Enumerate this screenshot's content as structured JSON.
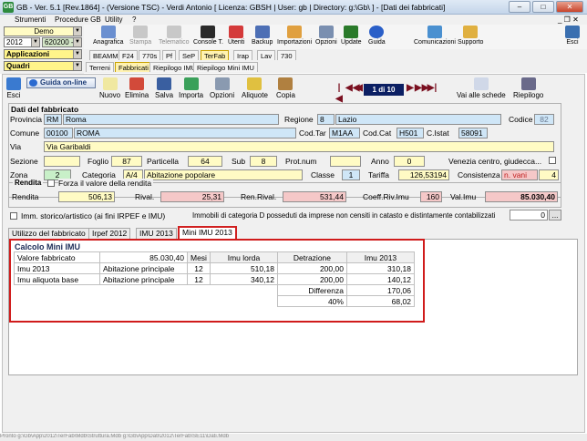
{
  "window": {
    "title": "GB - Ver. 5.1 [Rev.1864] - (Versione TSC) - Verdi Antonio [ Licenza: GBSH | User: gb | Directory: g:\\Gb\\ ] - [Dati dei fabbricati]",
    "min": "–",
    "max": "□",
    "close": "✕"
  },
  "menu": {
    "items": [
      "Strumenti",
      "Procedure GB",
      "Utility",
      "?"
    ],
    "restore": "_ ❐ ✕"
  },
  "left": {
    "company": "Demo",
    "year": "2012",
    "code": "620200 -",
    "module": "Applicazioni",
    "sub": "Quadri"
  },
  "toolbar": {
    "buttons": [
      "Anagrafica",
      "Stampa",
      "Telematico",
      "Console T.",
      "Utenti",
      "Backup",
      "Importazioni",
      "Opzioni",
      "Update",
      "Guida",
      "Comunicazioni",
      "Supporto",
      "Esci"
    ]
  },
  "tabs_row1": [
    "BEAMM",
    "F24",
    "770s",
    "Pf",
    "SeP",
    "TerFab",
    "Irap",
    "Lav",
    "730"
  ],
  "tabs_row2": [
    "Terreni",
    "Fabbricati",
    "Riepilogo IMU",
    "Riepilogo Mini IMU"
  ],
  "actions": {
    "esci": "Esci",
    "guida": "Guida on-line",
    "nuovo": "Nuovo",
    "elimina": "Elimina",
    "salva": "Salva",
    "importa": "Importa",
    "opzioni": "Opzioni",
    "aliquote": "Aliquote",
    "copia": "Copia",
    "vai": "Vai alle schede",
    "riepilogo": "Riepilogo",
    "pager": "1 di 10",
    "first": "|◀",
    "prev2": "◀◀",
    "prev": "◀",
    "next": "▶",
    "next2": "▶▶",
    "last": "▶|"
  },
  "dati": {
    "title": "Dati del fabbricato",
    "provincia_l": "Provincia",
    "provincia_code": "RM",
    "provincia_name": "Roma",
    "regione_l": "Regione",
    "regione_code": "8",
    "regione_name": "Lazio",
    "codice_l": "Codice",
    "codice": "82",
    "comune_l": "Comune",
    "comune_code": "00100",
    "comune_name": "ROMA",
    "codtar_l": "Cod.Tar",
    "codtar": "M1AA",
    "codcat_l": "Cod.Cat",
    "codcat": "H501",
    "cistat_l": "C.Istat",
    "cistat": "58091",
    "via_l": "Via",
    "via": "Via Garibaldi",
    "sezione_l": "Sezione",
    "sezione": "",
    "foglio_l": "Foglio",
    "foglio": "87",
    "particella_l": "Particella",
    "particella": "64",
    "sub_l": "Sub",
    "sub": "8",
    "protnum_l": "Prot.num",
    "protnum": "",
    "anno_l": "Anno",
    "anno": "0",
    "venezia_l": "Venezia centro, giudecca...",
    "zona_l": "Zona",
    "zona": "2",
    "categoria_l": "Categoria",
    "categoria": "A/4",
    "categoria_desc": "Abitazione popolare",
    "classe_l": "Classe",
    "classe": "1",
    "tariffa_l": "Tariffa",
    "tariffa": "126,53194",
    "consistenza_l": "Consistenza",
    "consistenza_u": "n. vani",
    "consistenza": "4"
  },
  "rendita": {
    "group": "Rendita",
    "forza": "Forza il valore della rendita",
    "rendita_l": "Rendita",
    "rendita": "506,13",
    "rival_l": "Rival.",
    "rival": "25,31",
    "renrival_l": "Ren.Rival.",
    "renrival": "531,44",
    "coeff_l": "Coeff.Riv.Imu",
    "coeff": "160",
    "valimu_l": "Val.Imu",
    "valimu": "85.030,40"
  },
  "storico": {
    "label": "Imm. storico/artistico (ai fini IRPEF e IMU)",
    "immobili": "Immobili di categoria D posseduti da imprese non censiti in catasto e distintamente contabilizzati",
    "value": "0",
    "dots": "..."
  },
  "tabs3": [
    "Utilizzo del fabbricato",
    "Irpef 2012",
    "IMU 2013",
    "Mini IMU 2013"
  ],
  "mini": {
    "title": "Calcolo Mini IMU",
    "valore_l": "Valore fabbricato",
    "valore": "85.030,40",
    "headers": [
      "Mesi",
      "Imu lorda",
      "Detrazione",
      "Imu 2013"
    ],
    "rows": [
      {
        "label": "Imu 2013",
        "tipo": "Abitazione principale",
        "mesi": "12",
        "lorda": "510,18",
        "detr": "200,00",
        "imu": "310,18"
      },
      {
        "label": "Imu aliquota base",
        "tipo": "Abitazione principale",
        "mesi": "12",
        "lorda": "340,12",
        "detr": "200,00",
        "imu": "140,12"
      }
    ],
    "diff_l": "Differenza",
    "diff": "170,06",
    "perc_l": "40%",
    "perc": "68,02"
  },
  "status": "Pronto                                                        g:\\Gb\\App\\2012\\TerFab\\Mdb\\Struttura.Mdb g:\\Gb\\App\\Dati\\2012\\TerFab\\SE11\\Dati.Mdb"
}
